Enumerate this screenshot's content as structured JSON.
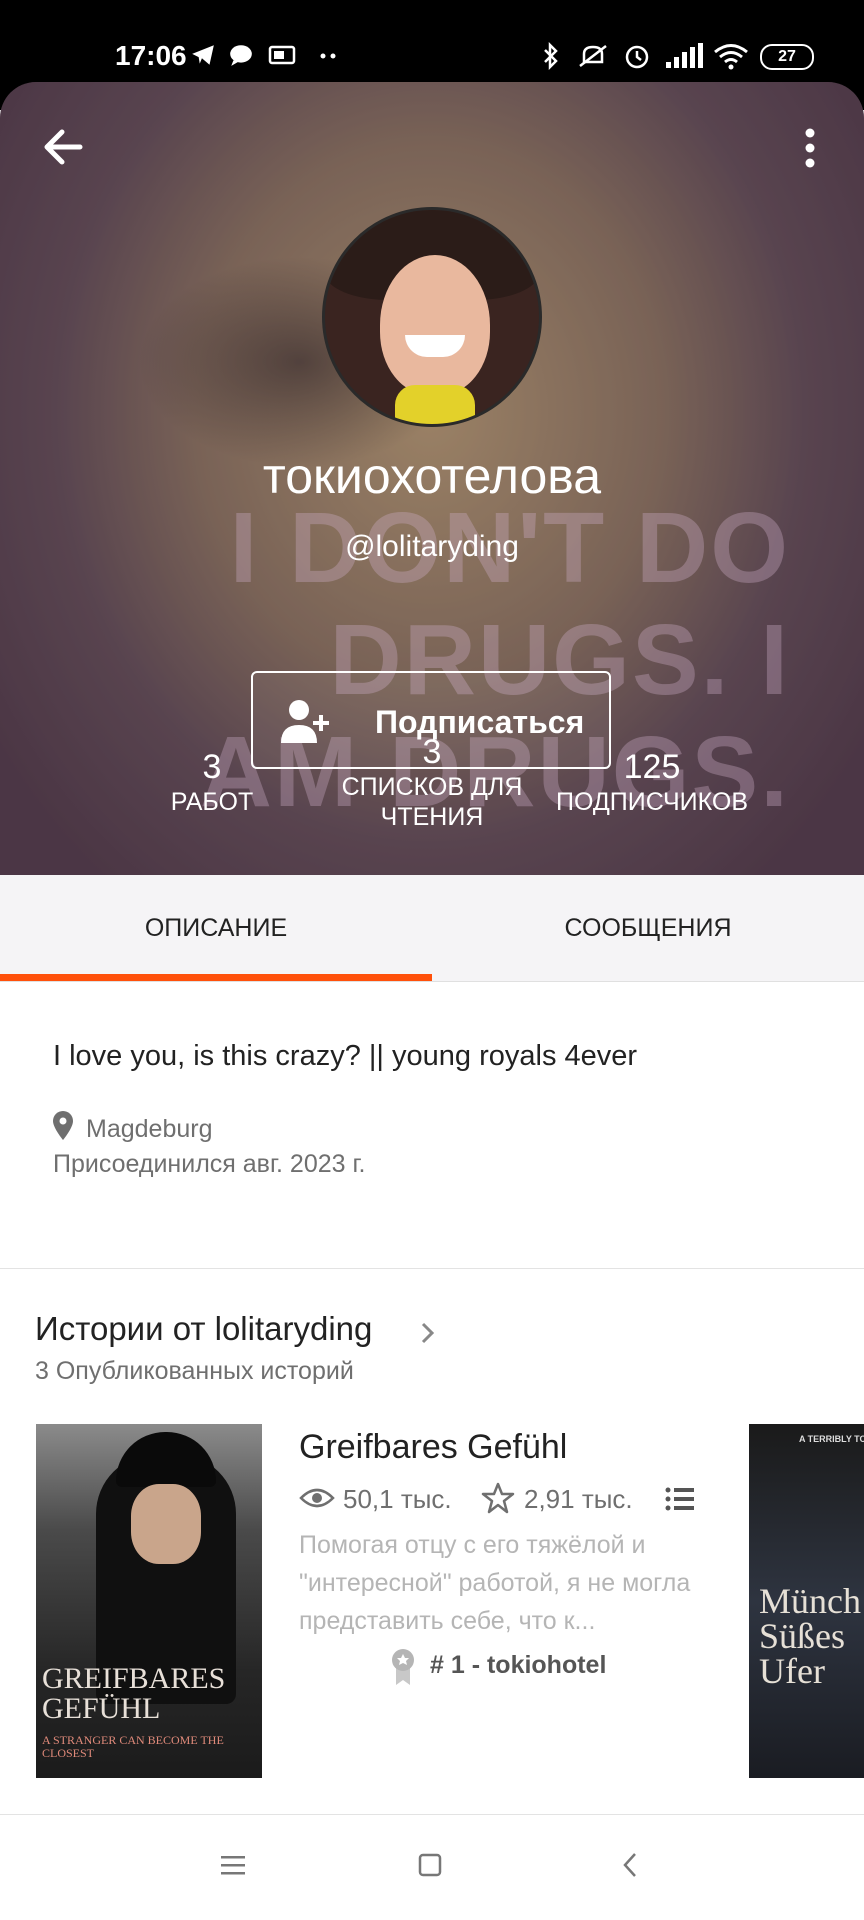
{
  "status_bar": {
    "time": "17:06",
    "icons": [
      "telegram-icon",
      "chat-icon",
      "mail-icon",
      "dots-icon",
      "bluetooth-icon",
      "mute-icon",
      "alarm-icon",
      "signal-icon",
      "wifi-icon"
    ],
    "battery": "27"
  },
  "profile": {
    "display_name": "токиохотелова",
    "username": "@lolitaryding",
    "follow_label": "Подписаться",
    "background_text": "I DON'T DO DRUGS. I AM DRUGS.",
    "stats": [
      {
        "value": "3",
        "label": "РАБОТ"
      },
      {
        "value": "3",
        "label_line1": "СПИСКОВ ДЛЯ",
        "label_line2": "ЧТЕНИЯ"
      },
      {
        "value": "125",
        "label": "ПОДПИСЧИКОВ"
      }
    ]
  },
  "tabs": [
    {
      "label": "ОПИСАНИЕ",
      "active": true
    },
    {
      "label": "СООБЩЕНИЯ",
      "active": false
    }
  ],
  "about": {
    "bio": "I love you, is this crazy? || young royals 4ever",
    "location": "Magdeburg",
    "joined": "Присоединился авг. 2023 г."
  },
  "stories": {
    "title": "Истории от lolitaryding",
    "count": "3 Опубликованных историй",
    "items": [
      {
        "title": "Greifbares Gefühl",
        "reads": "50,1 тыс.",
        "votes": "2,91 тыс.",
        "description": "Помогая отцу с его тяжёлой и \"интересной\" работой, я не могла представить себе, что к...",
        "rank": "# 1 - tokiohotel",
        "cover_title": "GREIFBARES GEFÜHL",
        "cover_tagline": "A STRANGER CAN BECOME THE CLOSEST"
      },
      {
        "cover_top": "A TERRIBLY TO",
        "cover_title": "Münch Süßes Ufer"
      }
    ]
  },
  "colors": {
    "accent": "#ff500a",
    "text": "#222222",
    "muted": "#6f6f6f"
  }
}
